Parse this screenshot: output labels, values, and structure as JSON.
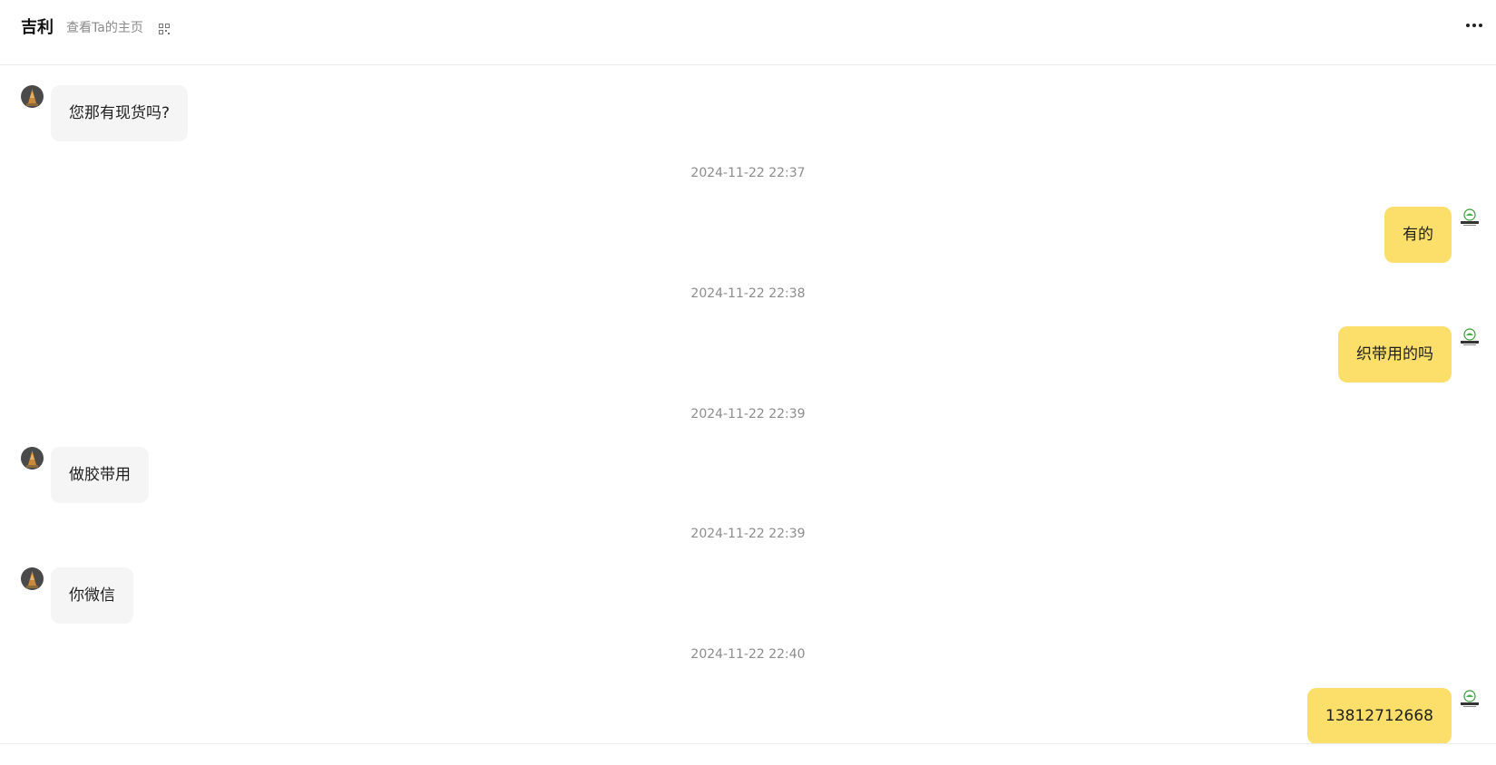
{
  "header": {
    "contact_name": "吉利",
    "profile_link": "查看Ta的主页"
  },
  "colors": {
    "incoming_bubble": "#f5f5f5",
    "outgoing_bubble": "#fbdf6a",
    "timestamp_text": "#8c8c8c"
  },
  "icons": {
    "qr": "qr-code-icon",
    "more": "more-options-icon"
  },
  "messages": [
    {
      "direction": "in",
      "text": "您那有现货吗?"
    },
    {
      "timestamp": "2024-11-22 22:37"
    },
    {
      "direction": "out",
      "text": "有的"
    },
    {
      "timestamp": "2024-11-22 22:38"
    },
    {
      "direction": "out",
      "text": "织带用的吗"
    },
    {
      "timestamp": "2024-11-22 22:39"
    },
    {
      "direction": "in",
      "text": "做胶带用"
    },
    {
      "timestamp": "2024-11-22 22:39"
    },
    {
      "direction": "in",
      "text": "你微信"
    },
    {
      "timestamp": "2024-11-22 22:40"
    },
    {
      "direction": "out",
      "text": "13812712668"
    }
  ]
}
